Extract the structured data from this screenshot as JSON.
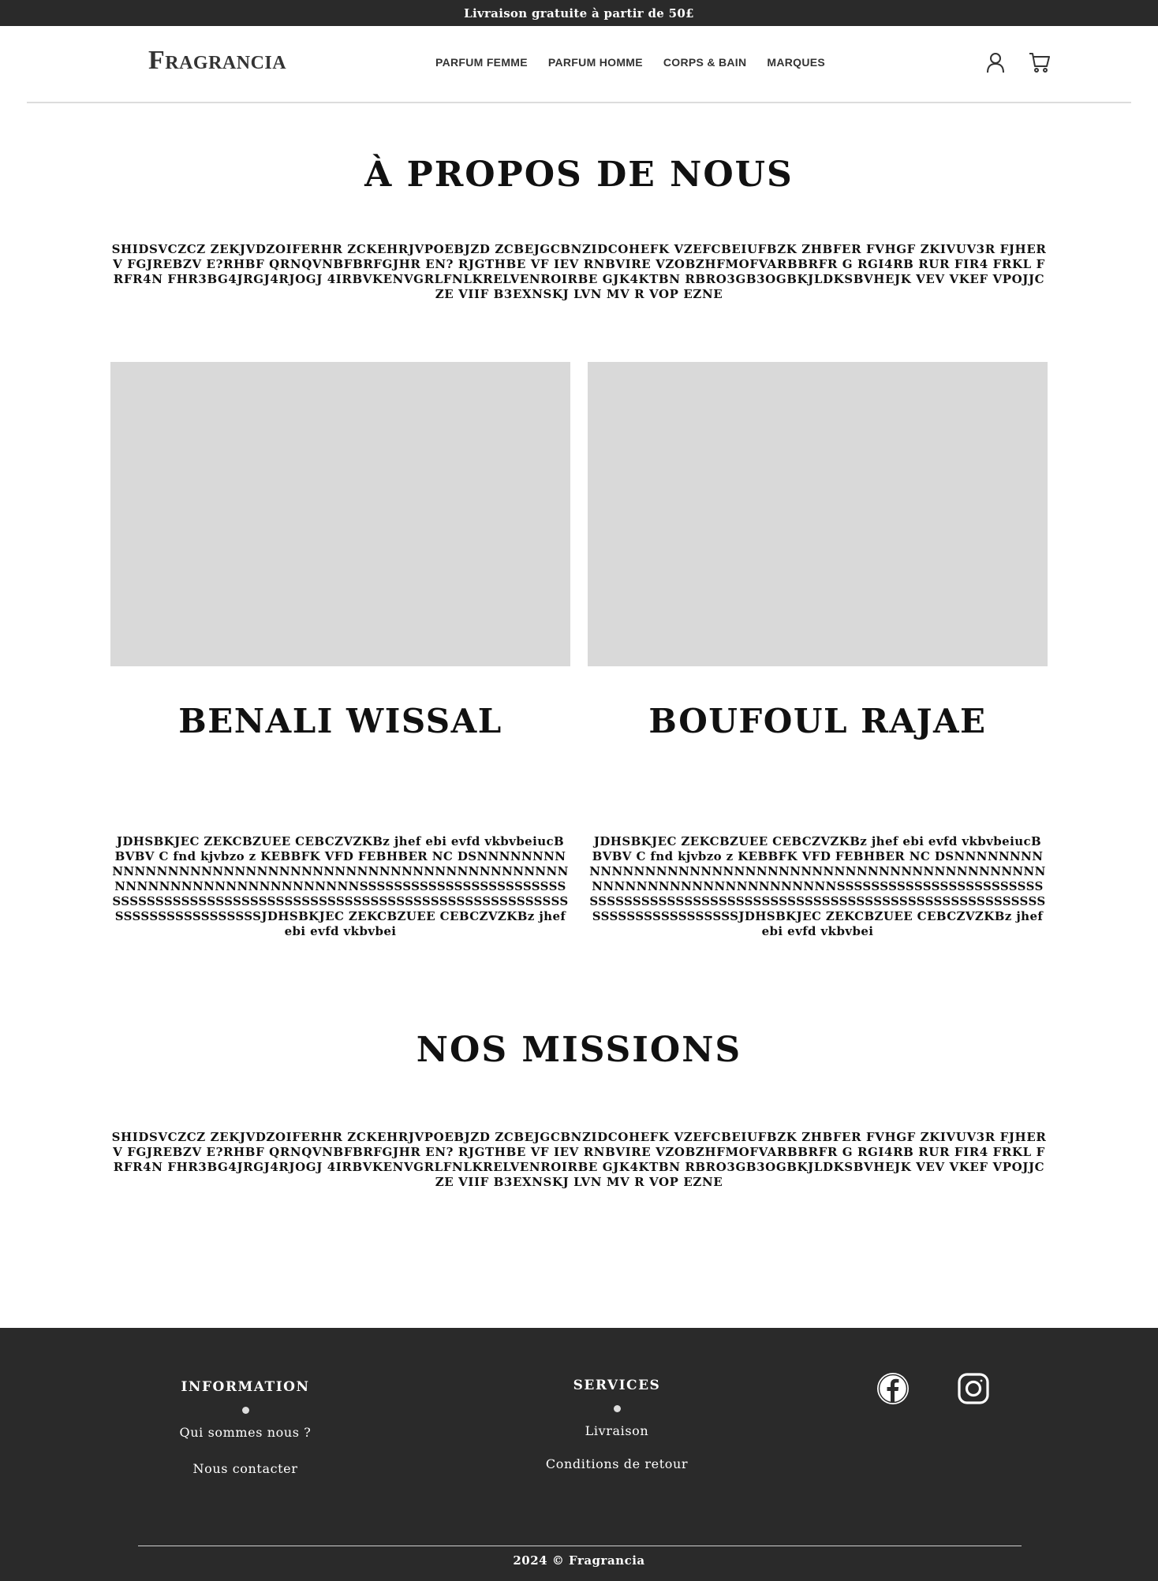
{
  "topbar": {
    "text": "Livraison gratuite à partir de 50£"
  },
  "header": {
    "logo": "Fragrancia",
    "nav": [
      "PARFUM FEMME",
      "PARFUM HOMME",
      "CORPS & BAIN",
      "MARQUES"
    ],
    "icons": [
      "user-icon",
      "cart-icon"
    ]
  },
  "about": {
    "title": "À PROPOS DE NOUS",
    "text": "SHIDSVCZCZ ZEKJVDZOIFERHR ZCKEHRJVPOEBJZD ZCBEJGCBNZIDCOHEFK VZEFCBEIUFBZK ZHBFER FVHGF ZKIVUV3R FJHERV FGJREBZV E?RHBF QRNQVNBFBRFGJHR EN? RJGTHBE VF IEV RNBVIRE VZOBZHFMOFVARBBRFR G RGI4RB RUR FIR4 FRKL FRFR4N FHR3BG4JRGJ4RJOGJ 4IRBVKENVGRLFNLKRELVENROIRBE GJK4KTBN RBRO3GB3OGBKJLDKSBVHEJK VEV VKEF VPOJJCZE VIIF B3EXNSKJ LVN MV R VOP EZNE"
  },
  "team": [
    {
      "name": "BENALI WISSAL",
      "bio": "JDHSBKJEC ZEKCBZUEE CEBCZVZKBz  jhef ebi evfd vkbvbeiucB BVBV C fnd kjvbzo z KEBBFK VFD  FEBHBER NC DSNNNNNNNNNNNNNNNNNNNNNNNNNNNNNNNNNNNNNNNNNNNNNNNNNNNNNNNNNNNNNNNNNNNNNNNSSSSSSSSSSSSSSSSSSSSSSSSSSSSSSSSSSSSSSSSSSSSSSSSSSSSSSSSSSSSSSSSSSSSSSSSSSSSSSSSSSSSSSSSSSSSSSJDHSBKJEC ZEKCBZUEE CEBCZVZKBz  jhef ebi evfd vkbvbei"
    },
    {
      "name": "BOUFOUL RAJAE",
      "bio": "JDHSBKJEC ZEKCBZUEE CEBCZVZKBz  jhef ebi evfd vkbvbeiucB BVBV C fnd kjvbzo z KEBBFK VFD  FEBHBER NC DSNNNNNNNNNNNNNNNNNNNNNNNNNNNNNNNNNNNNNNNNNNNNNNNNNNNNNNNNNNNNNNNNNNNNNNNSSSSSSSSSSSSSSSSSSSSSSSSSSSSSSSSSSSSSSSSSSSSSSSSSSSSSSSSSSSSSSSSSSSSSSSSSSSSSSSSSSSSSSSSSSSSSSJDHSBKJEC ZEKCBZUEE CEBCZVZKBz  jhef ebi evfd vkbvbei"
    }
  ],
  "missions": {
    "title": "NOS MISSIONS",
    "text": "SHIDSVCZCZ ZEKJVDZOIFERHR ZCKEHRJVPOEBJZD ZCBEJGCBNZIDCOHEFK VZEFCBEIUFBZK ZHBFER FVHGF ZKIVUV3R FJHERV FGJREBZV E?RHBF QRNQVNBFBRFGJHR EN? RJGTHBE VF IEV RNBVIRE VZOBZHFMOFVARBBRFR G RGI4RB RUR FIR4 FRKL FRFR4N FHR3BG4JRGJ4RJOGJ 4IRBVKENVGRLFNLKRELVENROIRBE GJK4KTBN RBRO3GB3OGBKJLDKSBVHEJK VEV VKEF VPOJJCZE VIIF B3EXNSKJ LVN MV R VOP EZNE"
  },
  "footer": {
    "information": {
      "heading": "INFORMATION",
      "links": [
        "Qui sommes nous ?",
        "Nous contacter"
      ]
    },
    "services": {
      "heading": "SERVICES",
      "links": [
        "Livraison",
        "Conditions de retour"
      ]
    },
    "social": [
      "facebook-icon",
      "instagram-icon"
    ],
    "copyright": "2024 © Fragrancia"
  }
}
